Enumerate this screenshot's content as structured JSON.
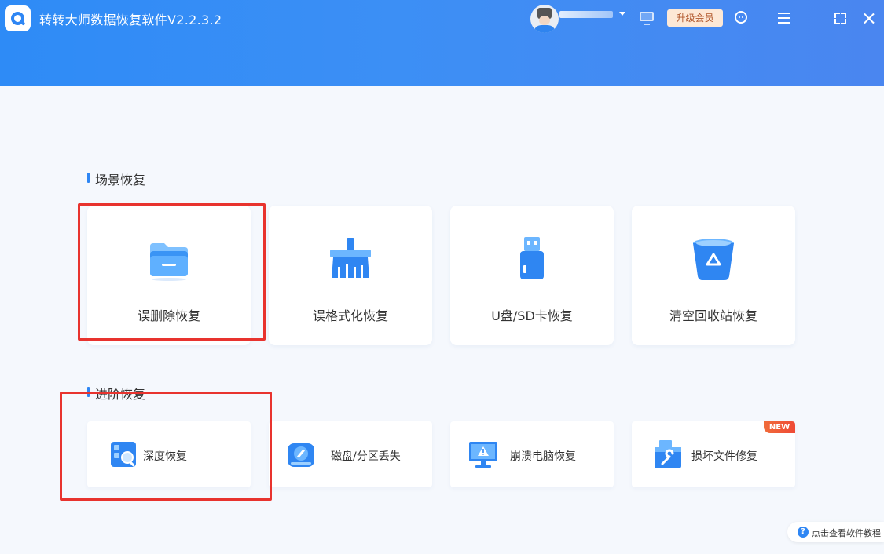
{
  "app": {
    "title": "转转大师数据恢复软件V2.2.3.2"
  },
  "header": {
    "upgrade_label": "升级会员"
  },
  "sections": {
    "scene": {
      "title": "场景恢复",
      "items": [
        {
          "label": "误删除恢复",
          "icon": "folder-icon"
        },
        {
          "label": "误格式化恢复",
          "icon": "broom-icon"
        },
        {
          "label": "U盘/SD卡恢复",
          "icon": "usb-drive-icon"
        },
        {
          "label": "清空回收站恢复",
          "icon": "recycle-bin-icon"
        }
      ]
    },
    "advanced": {
      "title": "进阶恢复",
      "items": [
        {
          "label": "深度恢复",
          "icon": "deep-scan-icon"
        },
        {
          "label": "磁盘/分区丢失",
          "icon": "disk-icon"
        },
        {
          "label": "崩溃电脑恢复",
          "icon": "crashed-monitor-icon"
        },
        {
          "label": "损坏文件修复",
          "icon": "file-repair-icon",
          "badge": "NEW"
        }
      ]
    }
  },
  "help": {
    "label": "点击查看软件教程"
  },
  "colors": {
    "accent": "#2e86f4",
    "highlight": "#e8332e",
    "badge": "#ef4a36"
  }
}
